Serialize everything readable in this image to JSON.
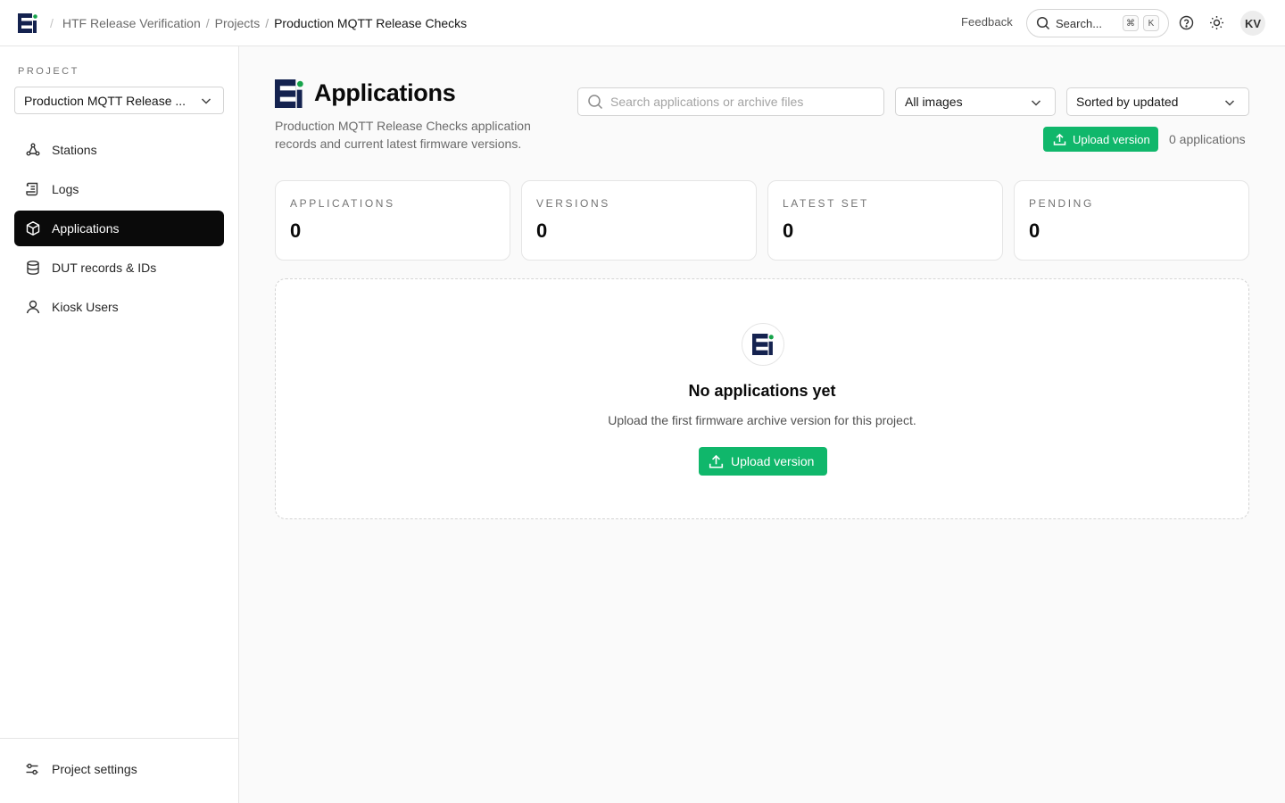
{
  "colors": {
    "accent": "#10b76b",
    "brand_navy": "#14224f",
    "brand_green": "#16a34a"
  },
  "breadcrumb": {
    "org": "HTF Release Verification",
    "projects": "Projects",
    "current": "Production MQTT Release Checks",
    "separator": "/"
  },
  "topbar": {
    "feedback": "Feedback",
    "search_label": "Search...",
    "kbd_cmd": "⌘",
    "kbd_k": "K",
    "avatar_initials": "KV"
  },
  "sidebar": {
    "project_label": "PROJECT",
    "project_selected": "Production MQTT Release ...",
    "items": [
      {
        "label": "Stations",
        "icon": "stations-icon"
      },
      {
        "label": "Logs",
        "icon": "logs-icon"
      },
      {
        "label": "Applications",
        "icon": "box-icon",
        "active": true
      },
      {
        "label": "DUT records & IDs",
        "icon": "database-icon"
      },
      {
        "label": "Kiosk Users",
        "icon": "user-icon"
      }
    ],
    "settings_label": "Project settings"
  },
  "main": {
    "title": "Applications",
    "description": "Production MQTT Release Checks application records and current latest firmware versions.",
    "search_placeholder": "Search applications or archive files",
    "filter_selected": "All images",
    "sort_selected": "Sorted by updated",
    "upload_label": "Upload version",
    "count_text": "0 applications",
    "stats": [
      {
        "label": "APPLICATIONS",
        "value": "0"
      },
      {
        "label": "VERSIONS",
        "value": "0"
      },
      {
        "label": "LATEST SET",
        "value": "0"
      },
      {
        "label": "PENDING",
        "value": "0"
      }
    ],
    "empty": {
      "title": "No applications yet",
      "subtitle": "Upload the first firmware archive version for this project.",
      "button_label": "Upload version"
    }
  }
}
